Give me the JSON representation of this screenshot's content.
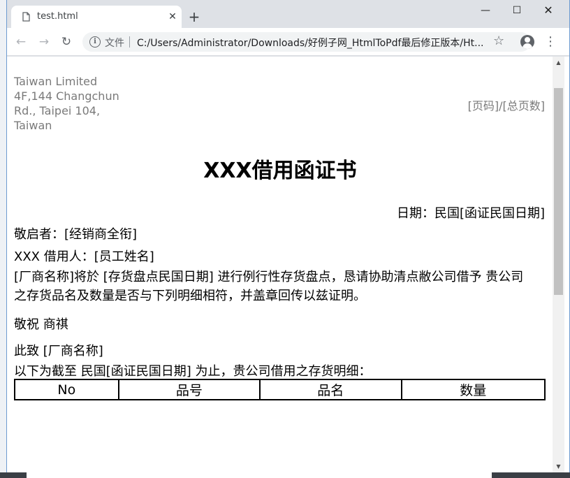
{
  "browser": {
    "tab_title": "test.html",
    "omnibox_scheme": "文件",
    "url": "C:/Users/Administrator/Downloads/好例子网_HtmlToPdf最后修正版本/Ht..."
  },
  "document": {
    "company": [
      "Taiwan Limited",
      "4F,144 Changchun",
      "Rd., Taipei 104,",
      "Taiwan"
    ],
    "page_number": "[页码]/[总页数]",
    "title": "XXX借用函证书",
    "date_line": "日期：民国[函证民国日期]",
    "salutation": "敬启者：[经销商全衔]",
    "borrower": "XXX 借用人：[员工姓名]",
    "paragraph": "[厂商名称]将於 [存货盘点民国日期] 进行例行性存货盘点，恳请协助清点敝公司借予  贵公司之存货品名及数量是否与下列明细相符，并盖章回传以兹证明。",
    "closing": "敬祝  商祺",
    "sender": "此致  [厂商名称]",
    "detail_intro": "以下为截至 民国[函证民国日期] 为止，贵公司借用之存货明细：",
    "table_headers": [
      "No",
      "品号",
      "品名",
      "数量"
    ]
  }
}
